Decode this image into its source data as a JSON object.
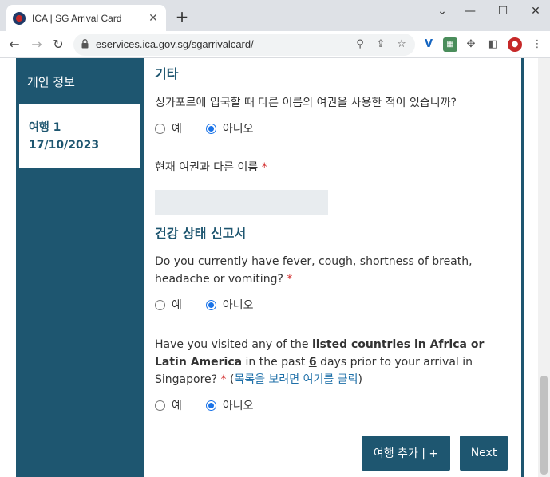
{
  "browser": {
    "tab_title": "ICA | SG Arrival Card",
    "new_tab": "+",
    "url": "eservices.ica.gov.sg/sgarrivalcard/"
  },
  "sidebar": {
    "item1": "개인 정보",
    "item2_line1": "여행 1",
    "item2_line2": "17/10/2023"
  },
  "others": {
    "heading": "기타",
    "question": "싱가포르에 입국할 때 다른 이름의 여권을 사용한 적이 있습니까?",
    "option_yes": "예",
    "option_no": "아니오",
    "selected": "아니오",
    "name_label": "현재 여권과 다른 이름",
    "name_value": ""
  },
  "health": {
    "heading": "건강 상태 신고서",
    "q1_text": "Do you currently have fever, cough, shortness of breath, headache or vomiting?",
    "q1_option_yes": "예",
    "q1_option_no": "아니오",
    "q1_selected": "아니오",
    "q2_part1": "Have you visited any of the ",
    "q2_bold1": "listed countries in Africa or Latin America",
    "q2_part2": " in the past ",
    "q2_days": "6",
    "q2_part3": " days prior to your arrival in Singapore?",
    "q2_link_paren_open": "(",
    "q2_link": "목록을 보려면 여기를 클릭",
    "q2_link_paren_close": ")",
    "q2_option_yes": "예",
    "q2_option_no": "아니오",
    "q2_selected": "아니오"
  },
  "buttons": {
    "add_trip": "여행 추가 | +",
    "next": "Next"
  },
  "required_mark": "*"
}
